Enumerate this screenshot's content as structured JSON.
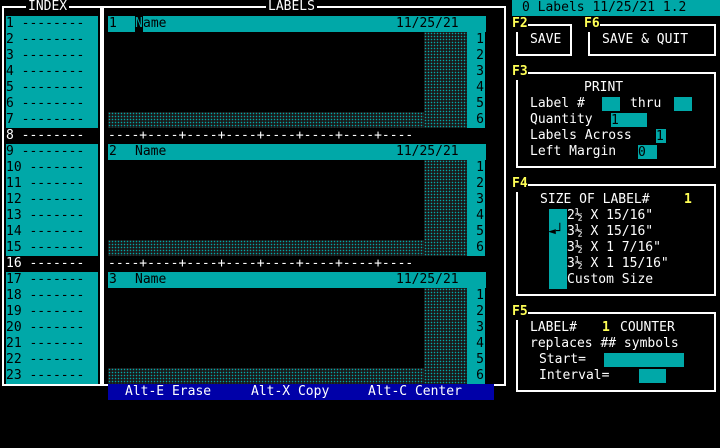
{
  "index": {
    "title": "INDEX",
    "rows": [
      "1 --------",
      "2 --------",
      "3 --------",
      "4 --------",
      "5 --------",
      "6 --------",
      "7 --------",
      "8 --------",
      "9 --------",
      "10 -------",
      "11 -------",
      "12 -------",
      "13 -------",
      "14 -------",
      "15 -------",
      "16 -------",
      "17 -------",
      "18 -------",
      "19 -------",
      "20 -------",
      "21 -------",
      "22 -------",
      "23 -------"
    ]
  },
  "labels_panel": {
    "title": "LABELS",
    "separator": "----+----+----+----+----+----+----+----",
    "labels": [
      {
        "num": "1",
        "name": "Name",
        "date": "11/25/21",
        "lines": [
          "1",
          "2",
          "3",
          "4",
          "5",
          "6"
        ]
      },
      {
        "num": "2",
        "name": "Name",
        "date": "11/25/21",
        "lines": [
          "1",
          "2",
          "3",
          "4",
          "5",
          "6"
        ]
      },
      {
        "num": "3",
        "name": "Name",
        "date": "11/25/21",
        "lines": [
          "1",
          "2",
          "3",
          "4",
          "5",
          "6"
        ]
      }
    ],
    "cursor_char": "N",
    "name_rest": "ame"
  },
  "status": {
    "title": "0 Labels 11/25/21 1.2"
  },
  "bottom_bar": {
    "erase": "Alt-E Erase",
    "copy": "Alt-X Copy",
    "center": "Alt-C Center"
  },
  "f2": {
    "key": "F2",
    "label": "SAVE"
  },
  "f6": {
    "key": "F6",
    "label": "SAVE & QUIT"
  },
  "f3": {
    "key": "F3",
    "heading": "PRINT",
    "label_num": "Label #",
    "thru": "thru",
    "label_from": "",
    "label_to": "",
    "quantity_label": "Quantity",
    "quantity_value": "1",
    "across_label": "Labels Across",
    "across_value": "1",
    "margin_label": "Left Margin",
    "margin_value": "0"
  },
  "f4": {
    "key": "F4",
    "heading": "SIZE OF LABEL#",
    "label_number": "1",
    "pointer": "◄┘",
    "sizes": [
      "2½ X 15/16\"",
      "3½ X 15/16\"",
      "3½ X 1 7/16\"",
      "3½ X 1 15/16\"",
      "Custom Size"
    ]
  },
  "f5": {
    "key": "F5",
    "label_hash": "LABEL#",
    "label_number": "1",
    "counter": "COUNTER",
    "replaces": "replaces ## symbols",
    "start_label": "Start=",
    "start_value": "",
    "interval_label": "Interval=",
    "interval_value": ""
  },
  "colors": {
    "teal": "#00a8a8",
    "yellow": "#ffff55",
    "black": "#000000",
    "white": "#ffffff"
  }
}
